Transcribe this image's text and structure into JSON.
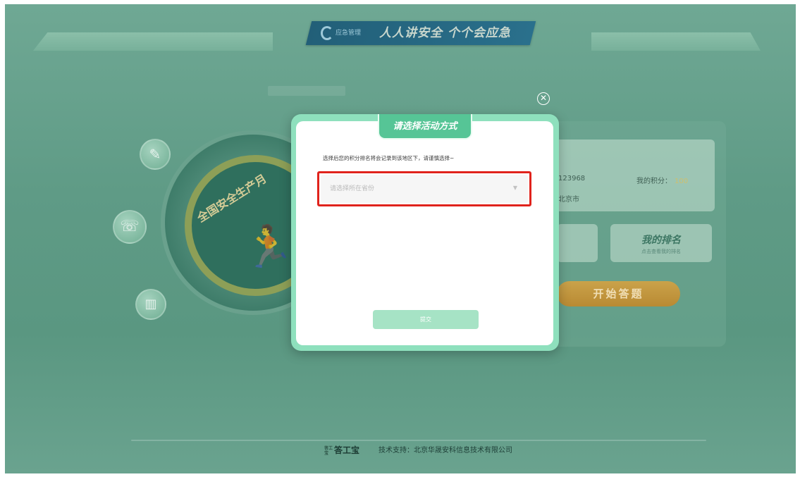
{
  "header": {
    "title": "人人讲安全 个个会应急",
    "logo_text": "应急管理"
  },
  "background": {
    "emblem_text": "全国安全生产月",
    "exit_sign": "⬿",
    "profile": {
      "id_text": "123968",
      "city_text": "北京市",
      "points_label": "我的积分：",
      "points_value": "100"
    },
    "my_ranking": {
      "title": "我的排名",
      "subtitle": "点击查看我的排名"
    },
    "start_button": "开始答题"
  },
  "modal": {
    "title": "请选择活动方式",
    "description": "选择后您的积分排名将会记录到该地区下，请谨慎选择~",
    "province_placeholder": "请选择所在省份",
    "submit_label": "提交"
  },
  "footer": {
    "logo_text": "答工宝",
    "logo_small": "答工宝",
    "support_text": "技术支持：北京华晟安科信息技术有限公司"
  },
  "colors": {
    "highlight": "#e0231c",
    "modal_border": "#8ee0bd",
    "tab_green": "#56c596",
    "submit_bg": "#a6e3c5"
  },
  "icons": {
    "close": "close-icon",
    "caret": "chevron-down-icon"
  }
}
